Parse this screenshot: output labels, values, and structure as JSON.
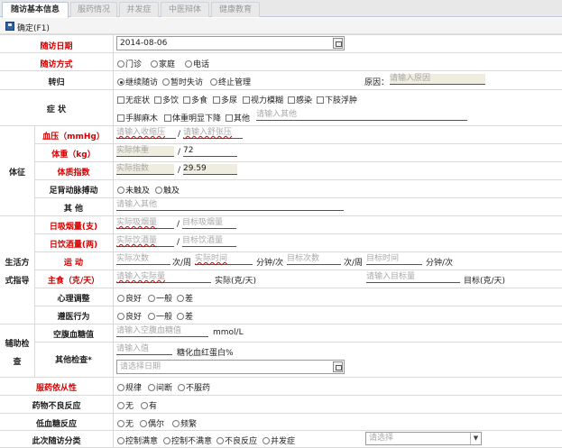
{
  "tabs": [
    "随访基本信息",
    "服药情况",
    "并发症",
    "中医辩体",
    "健康教育"
  ],
  "toolbar": {
    "confirm_label": "确定(F1)"
  },
  "visit_date": {
    "label": "随访日期",
    "value": "2014-08-06"
  },
  "visit_method": {
    "label": "随访方式",
    "options": [
      "门诊",
      "家庭",
      "电话"
    ]
  },
  "outcome": {
    "label": "转归",
    "options": [
      "继续随访",
      "暂时失访",
      "终止管理"
    ],
    "reason_label": "原因：",
    "reason_placeholder": "请输入原因"
  },
  "symptoms": {
    "label": "症  状",
    "row1": [
      "无症状",
      "多饮",
      "多食",
      "多尿",
      "视力模糊",
      "感染",
      "下肢浮肿"
    ],
    "row2": [
      "手脚麻木",
      "体重明显下降",
      "其他"
    ],
    "other_placeholder": "请输入其他"
  },
  "signs": {
    "group_label": "体征",
    "bp_label": "血压（mmHg）",
    "bp_systolic_placeholder": "请输入收缩压",
    "bp_diastolic_placeholder": "请输入舒张压",
    "weight_label": "体重（kg）",
    "weight_actual_placeholder": "实际体重",
    "weight_target": "72",
    "bmi_label": "体质指数",
    "bmi_actual_placeholder": "实际指数",
    "bmi_target": "29.59",
    "pulse_label": "足背动脉搏动",
    "pulse_options": [
      "未触及",
      "触及"
    ],
    "other_label": "其  他",
    "other_placeholder": "请输入其他"
  },
  "lifestyle": {
    "group_label_1": "生活方",
    "group_label_2": "式指导",
    "smoke_label": "日吸烟量(支)",
    "smoke_actual_placeholder": "实际吸烟量",
    "smoke_target_placeholder": "目标吸烟量",
    "drink_label": "日饮酒量(两)",
    "drink_actual_placeholder": "实际饮酒量",
    "drink_target_placeholder": "目标饮酒量",
    "exercise_label": "运  动",
    "exercise_count_placeholder": "实际次数",
    "exercise_time_placeholder": "实际时间",
    "exercise_target_count_placeholder": "目标次数",
    "exercise_target_time_placeholder": "目标时间",
    "unit_per_week": "次/周",
    "unit_min_per_time": "分钟/次",
    "staple_label": "主食（克/天）",
    "staple_actual_placeholder": "请输入实际量",
    "staple_actual_unit": "实际(克/天)",
    "staple_target_placeholder": "请输入目标量",
    "staple_target_unit": "目标(克/天)",
    "mental_label": "心理调整",
    "mental_options": [
      "良好",
      "一般",
      "差"
    ],
    "compliance_label": "遵医行为",
    "compliance_options": [
      "良好",
      "一般",
      "差"
    ]
  },
  "exam": {
    "group_label_1": "辅助检",
    "group_label_2": "查",
    "fbg_label": "空腹血糖值",
    "fbg_placeholder": "请输入空腹血糖值",
    "fbg_unit": "mmol/L",
    "other_label": "其他检查*",
    "hba1c_placeholder": "请输入值",
    "hba1c_unit": "糖化血红蛋白%",
    "date_placeholder": "请选择日期"
  },
  "adherence": {
    "label": "服药依从性",
    "options": [
      "规律",
      "间断",
      "不服药"
    ]
  },
  "adverse": {
    "label": "药物不良反应",
    "options": [
      "无",
      "有"
    ]
  },
  "hypo": {
    "label": "低血糖反应",
    "options": [
      "无",
      "偶尔",
      "频繁"
    ]
  },
  "classification": {
    "label": "此次随访分类",
    "options": [
      "控制满意",
      "控制不满意",
      "不良反应",
      "并发症"
    ],
    "select_placeholder": "请选择"
  }
}
